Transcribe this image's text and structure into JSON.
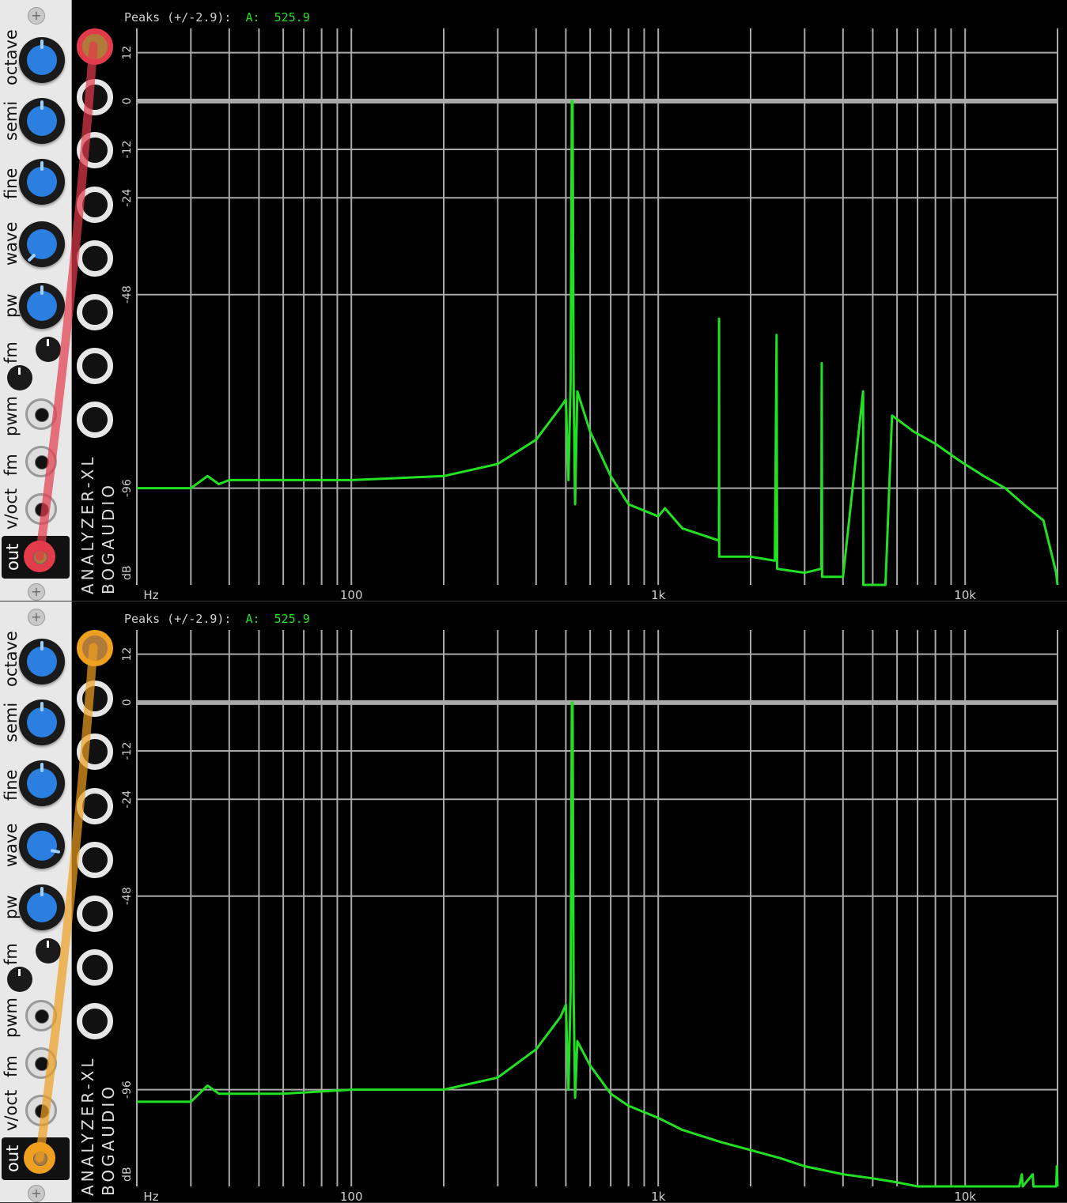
{
  "colors": {
    "trace": "#22e022",
    "grid": "#aaaaaa",
    "knob_blue": "#2a7fe0",
    "cable_red": "#e23b4a",
    "cable_orange": "#f0a020"
  },
  "modules": [
    {
      "oscillator": {
        "labels": [
          "octave",
          "semi",
          "fine",
          "wave",
          "pw",
          "fm",
          "pwm",
          "fm",
          "v/oct",
          "out"
        ],
        "cable_color": "#e23b4a"
      },
      "analyzer": {
        "title": "ANALYZER-XL",
        "brand": "BOGAUDIO",
        "peaks_label": "Peaks (+/-2.9):",
        "peaks_channel": "A:",
        "peaks_value": "525.9",
        "db_ticks": [
          "12",
          "0",
          "-12",
          "-24",
          "-48",
          "-96",
          "dB"
        ],
        "freq_ticks": [
          "Hz",
          "100",
          "1k",
          "10k"
        ]
      },
      "chart_data": {
        "type": "line",
        "title": "",
        "xlabel": "Hz",
        "ylabel": "dB",
        "xscale": "log",
        "xlim": [
          20,
          20000
        ],
        "ylim": [
          -120,
          18
        ],
        "grid": true,
        "y_ticks": [
          12,
          0,
          -12,
          -24,
          -48,
          -96
        ],
        "x_ticks": [
          100,
          1000,
          10000
        ],
        "series": [
          {
            "values": [
              [
                20,
                -96
              ],
              [
                30,
                -96
              ],
              [
                34,
                -93
              ],
              [
                37,
                -95
              ],
              [
                40,
                -94
              ],
              [
                60,
                -94
              ],
              [
                100,
                -94
              ],
              [
                200,
                -93
              ],
              [
                300,
                -90
              ],
              [
                400,
                -84
              ],
              [
                480,
                -76
              ],
              [
                500,
                -74
              ],
              [
                510,
                -94
              ],
              [
                518,
                -70
              ],
              [
                523,
                0
              ],
              [
                526,
                0
              ],
              [
                530,
                -70
              ],
              [
                536,
                -100
              ],
              [
                545,
                -72
              ],
              [
                600,
                -82
              ],
              [
                700,
                -93
              ],
              [
                800,
                -100
              ],
              [
                1000,
                -103
              ],
              [
                1052,
                -101
              ],
              [
                1200,
                -106
              ],
              [
                1577,
                -109
              ],
              [
                1578,
                -54
              ],
              [
                1580,
                -113
              ],
              [
                2000,
                -113
              ],
              [
                2400,
                -114
              ],
              [
                2430,
                -58
              ],
              [
                2440,
                -116
              ],
              [
                3000,
                -117
              ],
              [
                3400,
                -116
              ],
              [
                3410,
                -65
              ],
              [
                3420,
                -118
              ],
              [
                4000,
                -118
              ],
              [
                4650,
                -72
              ],
              [
                4660,
                -120
              ],
              [
                5500,
                -120
              ],
              [
                5780,
                -78
              ],
              [
                6800,
                -82
              ],
              [
                8000,
                -85
              ],
              [
                9500,
                -89
              ],
              [
                11500,
                -93
              ],
              [
                13500,
                -96
              ],
              [
                15500,
                -100
              ],
              [
                18000,
                -104
              ],
              [
                19800,
                -117
              ],
              [
                20000,
                -120
              ]
            ]
          }
        ]
      }
    },
    {
      "oscillator": {
        "labels": [
          "octave",
          "semi",
          "fine",
          "wave",
          "pw",
          "fm",
          "pwm",
          "fm",
          "v/oct",
          "out"
        ],
        "cable_color": "#f0a020"
      },
      "analyzer": {
        "title": "ANALYZER-XL",
        "brand": "BOGAUDIO",
        "peaks_label": "Peaks (+/-2.9):",
        "peaks_channel": "A:",
        "peaks_value": "525.9",
        "db_ticks": [
          "12",
          "0",
          "-12",
          "-24",
          "-48",
          "-96",
          "dB"
        ],
        "freq_ticks": [
          "Hz",
          "100",
          "1k",
          "10k"
        ]
      },
      "chart_data": {
        "type": "line",
        "title": "",
        "xlabel": "Hz",
        "ylabel": "dB",
        "xscale": "log",
        "xlim": [
          20,
          20000
        ],
        "ylim": [
          -120,
          18
        ],
        "grid": true,
        "y_ticks": [
          12,
          0,
          -12,
          -24,
          -48,
          -96
        ],
        "x_ticks": [
          100,
          1000,
          10000
        ],
        "series": [
          {
            "values": [
              [
                20,
                -99
              ],
              [
                30,
                -99
              ],
              [
                34,
                -95
              ],
              [
                37,
                -97
              ],
              [
                40,
                -97
              ],
              [
                60,
                -97
              ],
              [
                100,
                -96
              ],
              [
                200,
                -96
              ],
              [
                300,
                -93
              ],
              [
                400,
                -86
              ],
              [
                480,
                -78
              ],
              [
                500,
                -75
              ],
              [
                510,
                -96
              ],
              [
                518,
                -72
              ],
              [
                523,
                0
              ],
              [
                526,
                0
              ],
              [
                530,
                -72
              ],
              [
                536,
                -98
              ],
              [
                545,
                -84
              ],
              [
                600,
                -90
              ],
              [
                700,
                -97
              ],
              [
                800,
                -100
              ],
              [
                1000,
                -103
              ],
              [
                1200,
                -106
              ],
              [
                1600,
                -109
              ],
              [
                2000,
                -111
              ],
              [
                2500,
                -113
              ],
              [
                3000,
                -115
              ],
              [
                4000,
                -117
              ],
              [
                5000,
                -118
              ],
              [
                6000,
                -119
              ],
              [
                7000,
                -120
              ],
              [
                15000,
                -120
              ],
              [
                15300,
                -117
              ],
              [
                15400,
                -120
              ],
              [
                16600,
                -117
              ],
              [
                16700,
                -120
              ],
              [
                19800,
                -120
              ],
              [
                19900,
                -115
              ],
              [
                20000,
                -120
              ]
            ]
          }
        ]
      }
    }
  ]
}
